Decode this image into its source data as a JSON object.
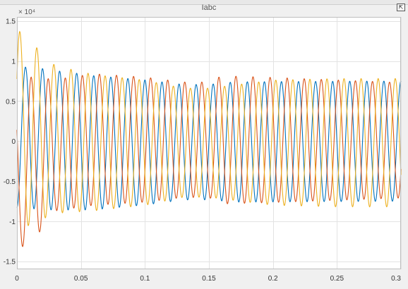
{
  "window": {
    "undock_symbol": "⇱"
  },
  "chart_data": {
    "type": "line",
    "title": "Iabc",
    "xlabel": "",
    "ylabel": "",
    "y_exponent_label": "× 10⁴",
    "xlim": [
      0,
      0.3
    ],
    "ylim": [
      -1.6,
      1.55
    ],
    "x_ticks": [
      0,
      0.05,
      0.1,
      0.15,
      0.2,
      0.25,
      0.3
    ],
    "x_tick_labels": [
      "0",
      "0.05",
      "0.1",
      "0.15",
      "0.2",
      "0.25",
      "0.3"
    ],
    "y_ticks": [
      -1.5,
      -1,
      -0.5,
      0,
      0.5,
      1,
      1.5
    ],
    "y_tick_labels": [
      "-1.5",
      "-1",
      "-0.5",
      "0",
      "0.5",
      "1",
      "1.5"
    ],
    "grid": true,
    "frequency_hz": 75,
    "series": [
      {
        "color": "#0072BD",
        "phase_deg": -90,
        "amplitude": [
          [
            0,
            0.88
          ],
          [
            0.02,
            0.88
          ],
          [
            0.05,
            0.85
          ],
          [
            0.1,
            0.78
          ],
          [
            0.13,
            0.72
          ],
          [
            0.15,
            0.72
          ],
          [
            0.17,
            0.75
          ],
          [
            0.2,
            0.75
          ],
          [
            0.25,
            0.75
          ],
          [
            0.3,
            0.75
          ]
        ],
        "offset": [
          [
            0,
            0.05
          ],
          [
            0.01,
            0.04
          ],
          [
            0.03,
            0.01
          ],
          [
            0.06,
            -0.02
          ],
          [
            0.3,
            0
          ]
        ]
      },
      {
        "color": "#D95319",
        "phase_deg": 150,
        "amplitude": [
          [
            0,
            0.98
          ],
          [
            0.01,
            1.05
          ],
          [
            0.03,
            0.82
          ],
          [
            0.06,
            0.82
          ],
          [
            0.1,
            0.78
          ],
          [
            0.13,
            0.72
          ],
          [
            0.15,
            0.72
          ],
          [
            0.16,
            0.8
          ],
          [
            0.2,
            0.78
          ],
          [
            0.25,
            0.75
          ],
          [
            0.3,
            0.72
          ]
        ],
        "offset": [
          [
            0,
            -0.35
          ],
          [
            0.01,
            -0.25
          ],
          [
            0.03,
            -0.05
          ],
          [
            0.06,
            0.02
          ],
          [
            0.3,
            0.01
          ]
        ]
      },
      {
        "color": "#EDB120",
        "phase_deg": 30,
        "amplitude": [
          [
            0,
            1.25
          ],
          [
            0.01,
            1.15
          ],
          [
            0.03,
            0.92
          ],
          [
            0.06,
            0.85
          ],
          [
            0.1,
            0.78
          ],
          [
            0.13,
            0.68
          ],
          [
            0.15,
            0.68
          ],
          [
            0.17,
            0.72
          ],
          [
            0.2,
            0.78
          ],
          [
            0.25,
            0.8
          ],
          [
            0.3,
            0.8
          ]
        ],
        "offset": [
          [
            0,
            0.15
          ],
          [
            0.01,
            0.1
          ],
          [
            0.03,
            0.02
          ],
          [
            0.06,
            -0.02
          ],
          [
            0.3,
            -0.02
          ]
        ]
      }
    ]
  }
}
